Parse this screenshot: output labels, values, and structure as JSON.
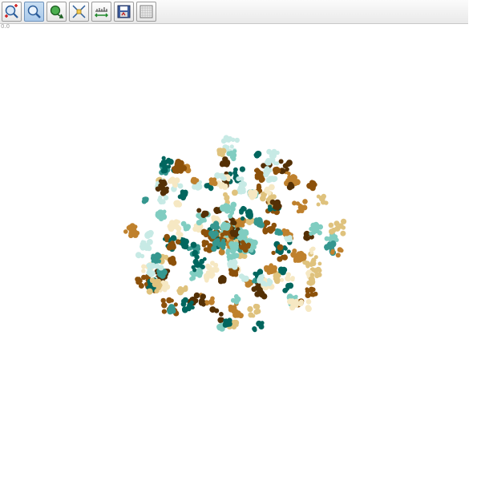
{
  "toolbar": {
    "buttons": [
      {
        "icon": "zoom-fit-icon",
        "active": false
      },
      {
        "icon": "zoom-icon",
        "active": true
      },
      {
        "icon": "pan-icon",
        "active": false
      },
      {
        "icon": "select-icon",
        "active": false
      },
      {
        "icon": "axis-scale-icon",
        "active": false
      },
      {
        "icon": "save-icon",
        "active": false
      },
      {
        "icon": "grid-icon",
        "active": false
      }
    ]
  },
  "scale_label": "0.0",
  "plot": {
    "type": "scatter",
    "palette": [
      "#01665e",
      "#35978f",
      "#80cdc1",
      "#c7eae5",
      "#f6e8c3",
      "#dfc27d",
      "#bf812d",
      "#8c510a",
      "#543005"
    ]
  }
}
